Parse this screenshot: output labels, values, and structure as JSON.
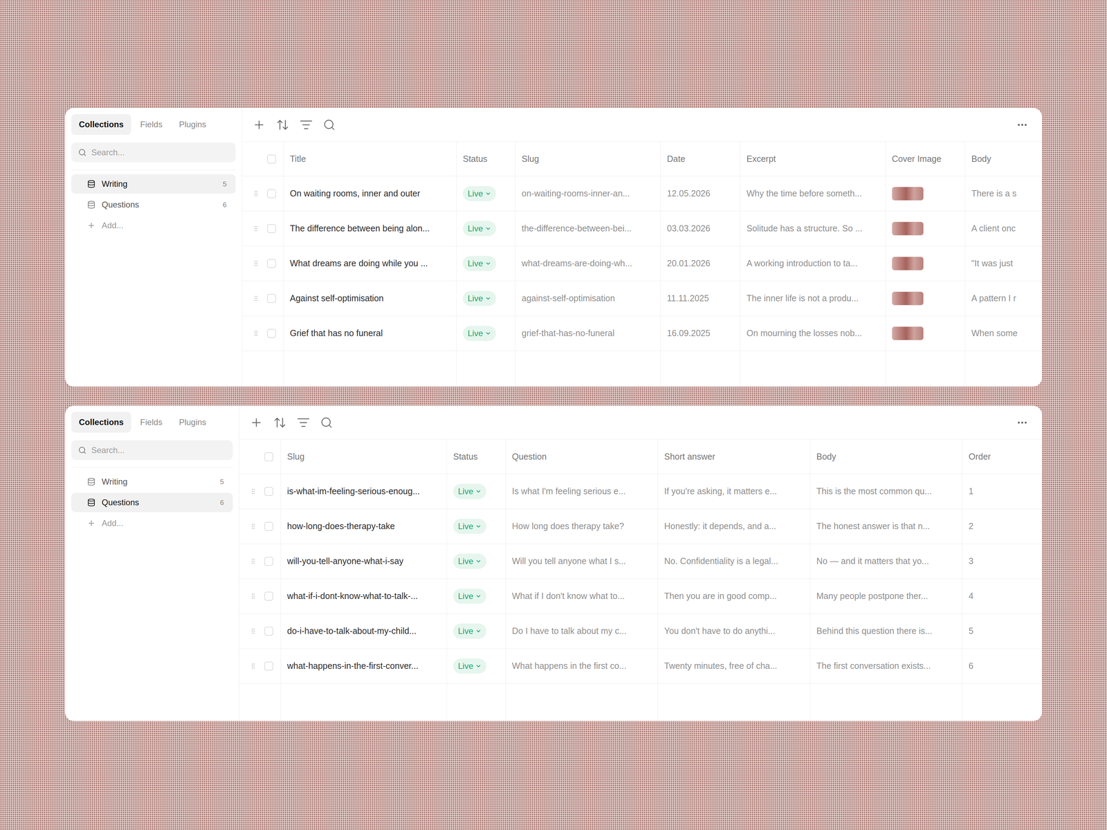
{
  "panels": [
    {
      "tabs": [
        {
          "label": "Collections",
          "selected": true
        },
        {
          "label": "Fields",
          "selected": false
        },
        {
          "label": "Plugins",
          "selected": false
        }
      ],
      "search": {
        "placeholder": "Search..."
      },
      "collections": [
        {
          "name": "Writing",
          "count": "5",
          "selected": true
        },
        {
          "name": "Questions",
          "count": "6",
          "selected": false
        }
      ],
      "add_label": "Add...",
      "table": {
        "header_checked": false,
        "columns": [
          {
            "label": "Title",
            "kind": "title"
          },
          {
            "label": "Status",
            "kind": "status"
          },
          {
            "label": "Slug",
            "kind": "text"
          },
          {
            "label": "Date",
            "kind": "text"
          },
          {
            "label": "Excerpt",
            "kind": "text"
          },
          {
            "label": "Cover Image",
            "kind": "image"
          },
          {
            "label": "Body",
            "kind": "text"
          }
        ],
        "rows": [
          {
            "checked": false,
            "cells": [
              "On waiting rooms, inner and outer",
              "Live",
              "on-waiting-rooms-inner-an...",
              "12.05.2026",
              "Why the time before someth...",
              true,
              "There is a s"
            ]
          },
          {
            "checked": false,
            "cells": [
              "The difference between being alon...",
              "Live",
              "the-difference-between-bei...",
              "03.03.2026",
              "Solitude has a structure. So ...",
              true,
              "A client onc"
            ]
          },
          {
            "checked": false,
            "cells": [
              "What dreams are doing while you ...",
              "Live",
              "what-dreams-are-doing-wh...",
              "20.01.2026",
              "A working introduction to ta...",
              true,
              "\"It was just"
            ]
          },
          {
            "checked": false,
            "cells": [
              "Against self-optimisation",
              "Live",
              "against-self-optimisation",
              "11.11.2025",
              "The inner life is not a produ...",
              true,
              "A pattern I r"
            ]
          },
          {
            "checked": false,
            "cells": [
              "Grief that has no funeral",
              "Live",
              "grief-that-has-no-funeral",
              "16.09.2025",
              "On mourning the losses nob...",
              true,
              "When some"
            ]
          }
        ]
      }
    },
    {
      "tabs": [
        {
          "label": "Collections",
          "selected": true
        },
        {
          "label": "Fields",
          "selected": false
        },
        {
          "label": "Plugins",
          "selected": false
        }
      ],
      "search": {
        "placeholder": "Search..."
      },
      "collections": [
        {
          "name": "Writing",
          "count": "5",
          "selected": false
        },
        {
          "name": "Questions",
          "count": "6",
          "selected": true
        }
      ],
      "add_label": "Add...",
      "table": {
        "header_checked": false,
        "columns": [
          {
            "label": "Slug",
            "kind": "title"
          },
          {
            "label": "Status",
            "kind": "status"
          },
          {
            "label": "Question",
            "kind": "text"
          },
          {
            "label": "Short answer",
            "kind": "text"
          },
          {
            "label": "Body",
            "kind": "text"
          },
          {
            "label": "Order",
            "kind": "text"
          }
        ],
        "rows": [
          {
            "checked": false,
            "cells": [
              "is-what-im-feeling-serious-enoug...",
              "Live",
              "Is what I'm feeling serious e...",
              "If you're asking, it matters e...",
              "This is the most common qu...",
              "1"
            ]
          },
          {
            "checked": false,
            "cells": [
              "how-long-does-therapy-take",
              "Live",
              "How long does therapy take?",
              "Honestly: it depends, and a...",
              "The honest answer is that n...",
              "2"
            ]
          },
          {
            "checked": false,
            "cells": [
              "will-you-tell-anyone-what-i-say",
              "Live",
              "Will you tell anyone what I s...",
              "No. Confidentiality is a legal...",
              "No — and it matters that yo...",
              "3"
            ]
          },
          {
            "checked": false,
            "cells": [
              "what-if-i-dont-know-what-to-talk-...",
              "Live",
              "What if I don't know what to...",
              "Then you are in good comp...",
              "Many people postpone ther...",
              "4"
            ]
          },
          {
            "checked": false,
            "cells": [
              "do-i-have-to-talk-about-my-child...",
              "Live",
              "Do I have to talk about my c...",
              "You don't have to do anythi...",
              "Behind this question there is...",
              "5"
            ]
          },
          {
            "checked": false,
            "cells": [
              "what-happens-in-the-first-conver...",
              "Live",
              "What happens in the first co...",
              "Twenty minutes, free of cha...",
              "The first conversation exists...",
              "6"
            ]
          }
        ]
      }
    }
  ]
}
